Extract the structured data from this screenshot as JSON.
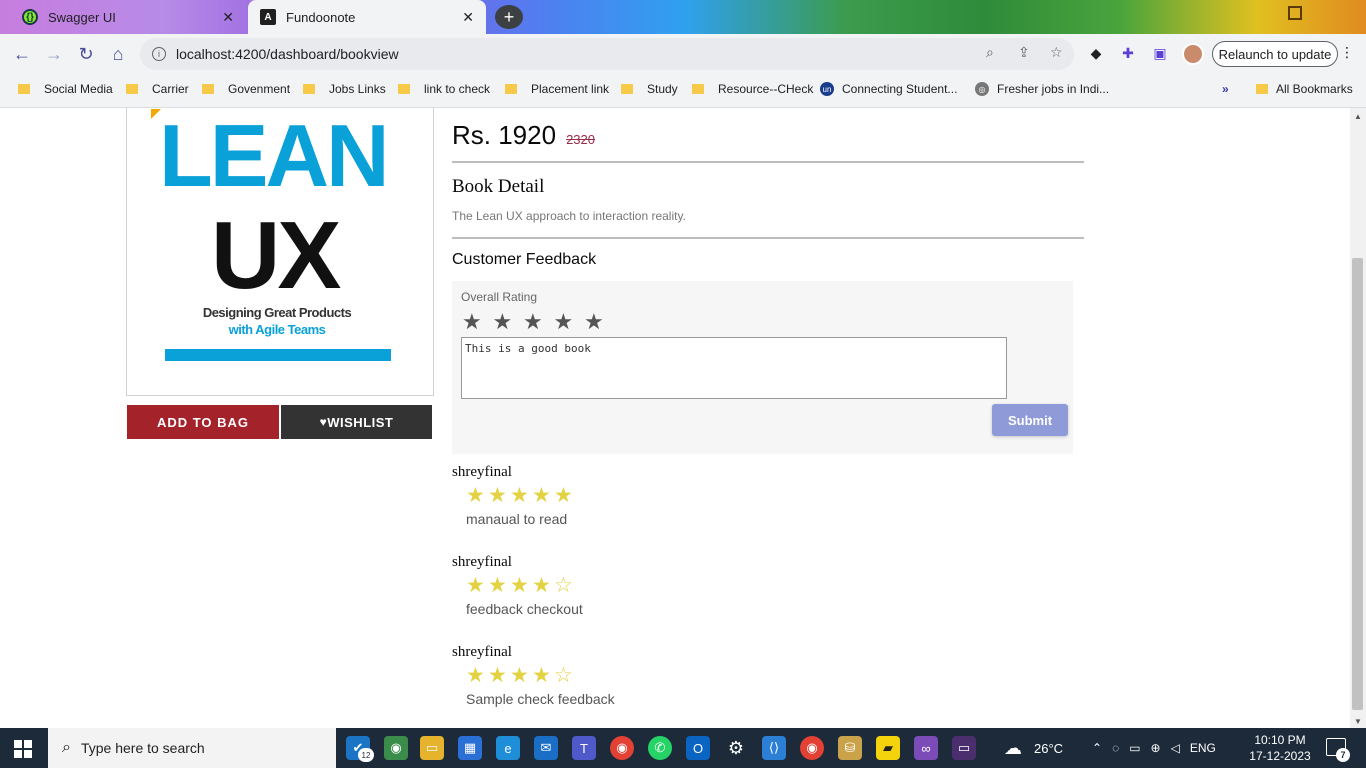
{
  "browser": {
    "tabs": [
      {
        "title": "Swagger UI",
        "icon": "swagger-icon",
        "active": false
      },
      {
        "title": "Fundoonote",
        "icon": "angular-icon",
        "active": true
      }
    ],
    "new_tab_label": "+",
    "url": "localhost:4200/dashboard/bookview",
    "relaunch_label": "Relaunch to update",
    "bookmarks": [
      {
        "label": "Social Media",
        "icon": "folder-icon"
      },
      {
        "label": "Carrier",
        "icon": "folder-icon"
      },
      {
        "label": "Govenment",
        "icon": "folder-icon"
      },
      {
        "label": "Jobs Links",
        "icon": "folder-icon"
      },
      {
        "label": "link to check",
        "icon": "folder-icon"
      },
      {
        "label": "Placement link",
        "icon": "folder-icon"
      },
      {
        "label": "Study",
        "icon": "folder-icon"
      },
      {
        "label": "Resource--CHeck",
        "icon": "folder-icon"
      },
      {
        "label": "Connecting Student...",
        "icon": "un-icon"
      },
      {
        "label": "Fresher jobs in Indi...",
        "icon": "globe-icon"
      }
    ],
    "bookmarks_overflow": "»",
    "all_bookmarks": "All Bookmarks"
  },
  "book": {
    "cover": {
      "title_line1": "LEAN",
      "title_line2": "UX",
      "subtitle_line1": "Designing Great Products",
      "subtitle_line2": "with Agile Teams"
    },
    "price_current": "Rs. 1920",
    "price_original": "2320",
    "add_to_bag_label": "ADD TO BAG",
    "wishlist_label": "WISHLIST",
    "detail_title": "Book Detail",
    "detail_text": "The Lean UX approach to interaction reality."
  },
  "feedback": {
    "title": "Customer Feedback",
    "rating_label": "Overall Rating",
    "rating_stars": [
      "★",
      "★",
      "★",
      "★",
      "★"
    ],
    "textarea_value": "This is a good book",
    "submit_label": "Submit"
  },
  "reviews": [
    {
      "name": "shreyfinal",
      "rating": 5,
      "stars": [
        "★",
        "★",
        "★",
        "★",
        "★"
      ],
      "comment": "manaual to read"
    },
    {
      "name": "shreyfinal",
      "rating": 4,
      "stars": [
        "★",
        "★",
        "★",
        "★",
        "☆"
      ],
      "comment": "feedback checkout"
    },
    {
      "name": "shreyfinal",
      "rating": 4,
      "stars": [
        "★",
        "★",
        "★",
        "★",
        "☆"
      ],
      "comment": "Sample check feedback"
    }
  ],
  "taskbar": {
    "search_placeholder": "Type here to search",
    "vscode_badge": "12",
    "weather": "26°C",
    "language": "ENG",
    "time": "10:10 PM",
    "date": "17-12-2023",
    "notification_count": "7"
  },
  "colors": {
    "add_to_bag": "#a4222a",
    "wishlist": "#333333",
    "submit": "#8e9bd8",
    "review_star": "#e3d242",
    "price_strike": "#9a2b4a"
  }
}
